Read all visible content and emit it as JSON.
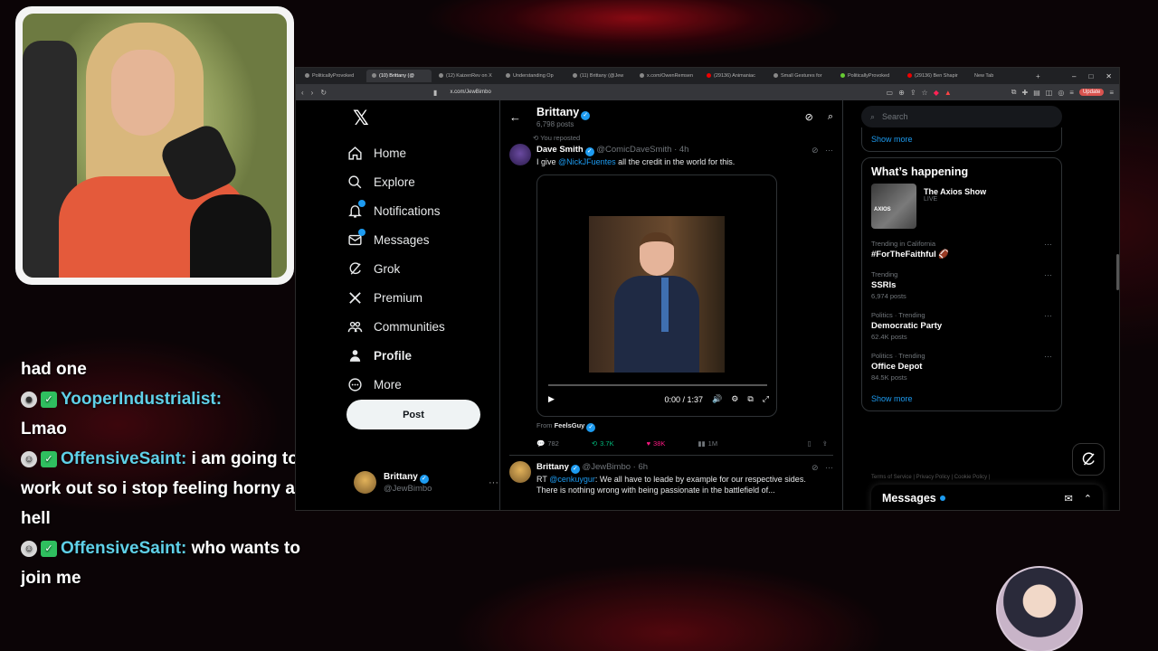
{
  "stream_chat": [
    {
      "user": "",
      "message": "had one",
      "badges": false
    },
    {
      "user": "YooperIndustrialist:",
      "message": "Lmao",
      "badges": true
    },
    {
      "user": "OffensiveSaint:",
      "message": "i am going to work out so i stop feeling horny as hell",
      "badges": true
    },
    {
      "user": "OffensiveSaint:",
      "message": "who wants to join me",
      "badges": true
    }
  ],
  "browser": {
    "tabs": [
      "PoliticallyProvoked",
      "(10) Brittany (@",
      "(12) KaizenRev on X",
      "Understanding Op",
      "(11) Brittany (@Jew",
      "x.com/OwenRemsen",
      "(29136) Animaniac",
      "Small Gestures for",
      "PoliticallyProvoked",
      "(29136) Ben Shapir",
      "New Tab"
    ],
    "active_tab_index": 1,
    "url": "x.com/JewBimbo",
    "update_label": "Update"
  },
  "nav": {
    "items": [
      {
        "label": "Home",
        "icon": "home-icon",
        "bold": false,
        "dot": false
      },
      {
        "label": "Explore",
        "icon": "search-icon",
        "bold": false,
        "dot": false
      },
      {
        "label": "Notifications",
        "icon": "bell-icon",
        "bold": false,
        "dot": true
      },
      {
        "label": "Messages",
        "icon": "mail-icon",
        "bold": false,
        "dot": true
      },
      {
        "label": "Grok",
        "icon": "grok-icon",
        "bold": false,
        "dot": false
      },
      {
        "label": "Premium",
        "icon": "x-logo-icon",
        "bold": false,
        "dot": false
      },
      {
        "label": "Communities",
        "icon": "people-icon",
        "bold": false,
        "dot": false
      },
      {
        "label": "Profile",
        "icon": "person-icon",
        "bold": true,
        "dot": false
      },
      {
        "label": "More",
        "icon": "more-circle-icon",
        "bold": false,
        "dot": false
      }
    ],
    "post_label": "Post",
    "account": {
      "name": "Brittany",
      "handle": "@JewBimbo"
    }
  },
  "profile_header": {
    "name": "Brittany",
    "posts": "6,798 posts"
  },
  "posts": {
    "p1": {
      "repost_label": "You reposted",
      "name": "Dave Smith",
      "handle": "@ComicDaveSmith",
      "time": "· 4h",
      "text_before": "I give ",
      "mention": "@NickJFuentes",
      "text_after": " all the credit in the world for this.",
      "video_time": "0:00 / 1:37",
      "from_label": "From ",
      "from_name": "FeelsGuy",
      "replies": "782",
      "reposts": "3.7K",
      "likes": "38K",
      "views": "1M"
    },
    "p2": {
      "name": "Brittany",
      "handle": "@JewBimbo",
      "time": "· 6h",
      "text_prefix": "RT ",
      "mention": "@cenkuygur",
      "text_after": ": We all have to leade by example for our respective sides.",
      "text_line2": "There is nothing wrong with being passionate in the battlefield of..."
    }
  },
  "sidebar": {
    "search_placeholder": "Search",
    "show_more": "Show more",
    "happening_title": "What’s happening",
    "axios": {
      "name": "The Axios Show",
      "status": "LIVE",
      "thumb_text": "AXIOS"
    },
    "trends": [
      {
        "category": "Trending in California",
        "name": "#ForTheFaithful 🏈",
        "count": ""
      },
      {
        "category": "Trending",
        "name": "SSRIs",
        "count": "6,974 posts"
      },
      {
        "category": "Politics · Trending",
        "name": "Democratic Party",
        "count": "62.4K posts"
      },
      {
        "category": "Politics · Trending",
        "name": "Office Depot",
        "count": "84.5K posts"
      }
    ],
    "show_more_2": "Show more",
    "footer": "Terms of Service  |  Privacy Policy  |  Cookie Policy  |"
  },
  "messages_drawer": {
    "title": "Messages"
  },
  "colors": {
    "accent": "#1d9bf0",
    "like": "#f91880",
    "repost": "#00ba7c",
    "background": "#000000"
  }
}
